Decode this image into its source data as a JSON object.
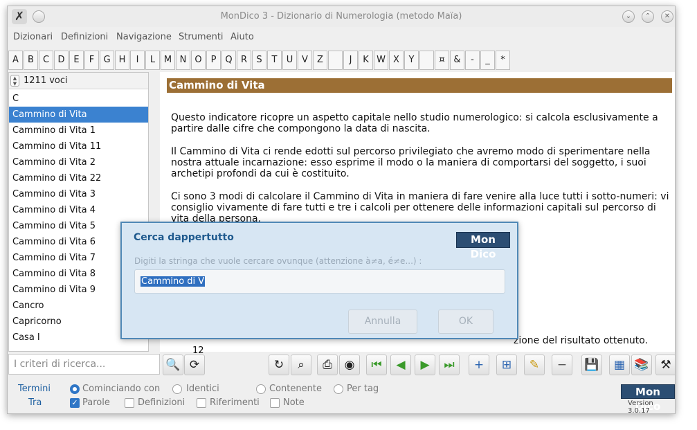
{
  "window": {
    "title": "MonDico 3 - Dizionario di Numerologia (metodo Maïa)"
  },
  "menu": [
    "Dizionari",
    "Definizioni",
    "Navigazione",
    "Strumenti",
    "Aiuto"
  ],
  "alphabet": [
    "A",
    "B",
    "C",
    "D",
    "E",
    "F",
    "G",
    "H",
    "I",
    "L",
    "M",
    "N",
    "O",
    "P",
    "Q",
    "R",
    "S",
    "T",
    "U",
    "V",
    "Z",
    "J",
    "K",
    "W",
    "X",
    "Y",
    "¤",
    "&",
    "-",
    "_",
    "*"
  ],
  "list": {
    "count": "1211 voci",
    "items": [
      "C",
      "Cammino di Vita",
      "Cammino di Vita 1",
      "Cammino di Vita 11",
      "Cammino di Vita 2",
      "Cammino di Vita 22",
      "Cammino di Vita 3",
      "Cammino di Vita 4",
      "Cammino di Vita 5",
      "Cammino di Vita 6",
      "Cammino di Vita 7",
      "Cammino di Vita 8",
      "Cammino di Vita 9",
      "Cancro",
      "Capricorno",
      "Casa I"
    ],
    "selected_index": 1
  },
  "content": {
    "heading": "Cammino di Vita",
    "paragraphs": [
      "Questo indicatore ricopre un aspetto capitale nello studio numerologico: si calcola esclusivamente a partire dalle cifre che compongono la data di nascita.",
      "Il Cammino di Vita ci rende edotti sul percorso privilegiato che avremo modo di sperimentare nella nostra attuale incarnazione: esso esprime il modo o la maniera di comportarsi del soggetto, i suoi archetipi profondi da cui è costituito.",
      "Ci sono 3 modi di calcolare il Cammino di Vita in maniera di fare venire alla luce tutti i sotto-numeri: vi consiglio vivamente di fare tutti e tre i calcoli per ottenere delle informazioni capitali sul percorso di vita della persona."
    ],
    "partial_tail": "zione del risultato ottenuto.",
    "partial_number": "12"
  },
  "search": {
    "placeholder": "I criteri di ricerca..."
  },
  "toolbar_icons": [
    "magnifier-icon",
    "refresh-icon",
    "reload-icon",
    "zoom-icon",
    "print-icon",
    "globe-icon",
    "first-icon",
    "previous-icon",
    "next-icon",
    "last-icon",
    "add-icon",
    "add-page-icon",
    "edit-icon",
    "remove-icon",
    "save-icon",
    "export-icon",
    "books-icon",
    "tools-icon"
  ],
  "options": {
    "termini_label": "Termini",
    "tra_label": "Tra",
    "radios": [
      {
        "label": "Cominciando con",
        "checked": true
      },
      {
        "label": "Identici",
        "checked": false
      },
      {
        "label": "Contenente",
        "checked": false
      },
      {
        "label": "Per tag",
        "checked": false
      }
    ],
    "checks": [
      {
        "label": "Parole",
        "checked": true
      },
      {
        "label": "Definizioni",
        "checked": false
      },
      {
        "label": "Riferimenti",
        "checked": false
      },
      {
        "label": "Note",
        "checked": false
      }
    ]
  },
  "brand": {
    "logo": "Mon Dico",
    "version": "Version 3.0.17"
  },
  "dialog": {
    "title": "Cerca dappertutto",
    "logo": "Mon Dico",
    "prompt": "Digiti la stringa che vuole cercare ovunque (attenzione à≠a, é≠e...) :",
    "value": "Cammino di V",
    "cancel_label": "Annulla",
    "ok_label": "OK"
  },
  "colors": {
    "heading_bg": "#9c6f35",
    "selection": "#3b82d0",
    "dialog_bg": "#d7e6f3",
    "logo_bg": "#2c4e73"
  }
}
